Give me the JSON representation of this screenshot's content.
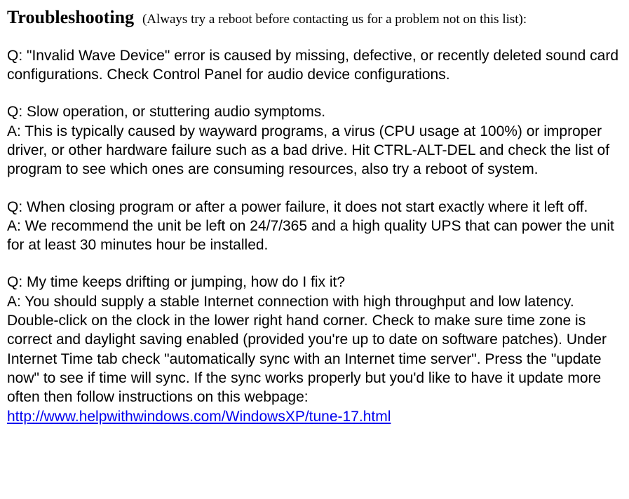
{
  "header": {
    "title": "Troubleshooting",
    "subtitle": "(Always try a reboot before contacting us for a problem not on this list):"
  },
  "items": [
    {
      "q": "Q: \"Invalid Wave Device\" error is caused by missing, defective, or recently deleted sound card configurations.  Check Control Panel for audio device configurations."
    },
    {
      "q": "Q: Slow operation, or stuttering audio symptoms.",
      "a": "A: This is typically caused by wayward programs, a virus (CPU usage at 100%) or improper driver, or other hardware failure such as a bad drive.  Hit CTRL-ALT-DEL and check the list of program to see which ones are consuming resources, also try a reboot of system."
    },
    {
      "q": "Q: When closing program or after a power failure, it does not start exactly where it left off.",
      "a": "A: We recommend the unit be left on 24/7/365 and a high quality UPS that can power the unit for at least 30 minutes hour be installed."
    },
    {
      "q": "Q: My time keeps drifting or jumping, how do I fix it?",
      "a_prefix": "A: You should supply a stable Internet connection with high throughput and low latency.  Double-click on the clock in the lower right hand corner.  Check to make sure time zone is correct and daylight saving enabled (provided you're up to date on software patches).  Under Internet Time tab check \"automatically sync with an Internet time server\".  Press the \"update now\" to see if time will sync.  If the sync works properly but you'd like to have it update more often then follow instructions on this webpage: ",
      "link_text": "http://www.helpwithwindows.com/WindowsXP/tune-17.html"
    }
  ]
}
